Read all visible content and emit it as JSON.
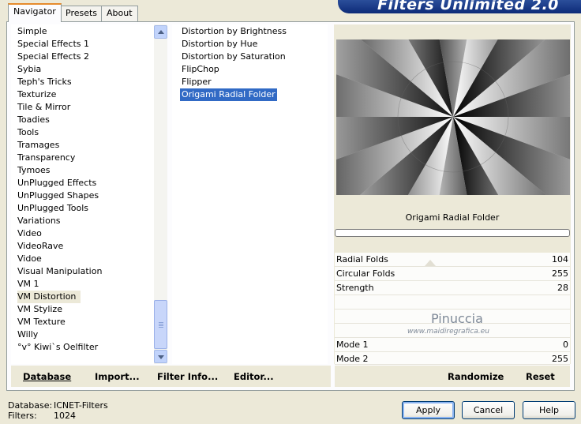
{
  "tabs": [
    "Navigator",
    "Presets",
    "About"
  ],
  "banner_title": "Filters Unlimited 2.0",
  "categories": [
    "Simple",
    "Special Effects 1",
    "Special Effects 2",
    "Sybia",
    "Teph's Tricks",
    "Texturize",
    "Tile & Mirror",
    "Toadies",
    "Tools",
    "Tramages",
    "Transparency",
    "Tymoes",
    "UnPlugged Effects",
    "UnPlugged Shapes",
    "UnPlugged Tools",
    "Variations",
    "Video",
    "VideoRave",
    "Vidoe",
    "Visual Manipulation",
    "VM 1",
    "VM Distortion",
    "VM Stylize",
    "VM Texture",
    "Willy",
    "°v° Kiwi`s Oelfilter"
  ],
  "selected_category": "VM Distortion",
  "filters": [
    "Distortion by Brightness",
    "Distortion by Hue",
    "Distortion by Saturation",
    "FlipChop",
    "Flipper",
    "Origami Radial Folder"
  ],
  "selected_filter": "Origami Radial Folder",
  "preview_title": "Origami Radial Folder",
  "params": [
    {
      "label": "Radial Folds",
      "value": "104"
    },
    {
      "label": "Circular Folds",
      "value": "255"
    },
    {
      "label": "Strength",
      "value": "28"
    }
  ],
  "params2": [
    {
      "label": "Mode 1",
      "value": "0"
    },
    {
      "label": "Mode 2",
      "value": "255"
    }
  ],
  "watermark": {
    "name": "Pinuccia",
    "url": "www.maidiregrafica.eu"
  },
  "toolbar": {
    "database": "Database",
    "import": "Import...",
    "filter_info": "Filter Info...",
    "editor": "Editor...",
    "randomize": "Randomize",
    "reset": "Reset"
  },
  "footer": {
    "db_label": "Database:",
    "db_value": "ICNET-Filters",
    "filters_label": "Filters:",
    "filters_value": "1024"
  },
  "buttons": {
    "apply": "Apply",
    "cancel": "Cancel",
    "help": "Help"
  }
}
